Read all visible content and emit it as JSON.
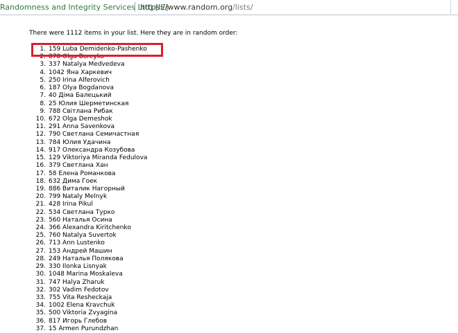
{
  "address_bar": {
    "identity": "Randomness and Integrity Services Ltd) [IE]",
    "url_host": "https://www.random.org",
    "url_path": "/lists/"
  },
  "page": {
    "intro": "There were 1112 items in your list. Here they are in random order:",
    "items": [
      {
        "n": "1.",
        "text": "159 Luba Demidenko-Pashenko"
      },
      {
        "n": "2.",
        "text": "878 Olga Boreyko"
      },
      {
        "n": "3.",
        "text": "337 Natalya Medvedeva"
      },
      {
        "n": "4.",
        "text": "1042 Яна Харкевич"
      },
      {
        "n": "5.",
        "text": "250 Irina Alferovich"
      },
      {
        "n": "6.",
        "text": "187 Olya Bogdanova"
      },
      {
        "n": "7.",
        "text": "40 Діма Балецький"
      },
      {
        "n": "8.",
        "text": "25 Юлия Шерметинская"
      },
      {
        "n": "9.",
        "text": "788 Світлана Рибак"
      },
      {
        "n": "10.",
        "text": "672 Olga Demeshok"
      },
      {
        "n": "11.",
        "text": "291 Anna Savenkova"
      },
      {
        "n": "12.",
        "text": "790 Светлана Семичастная"
      },
      {
        "n": "13.",
        "text": "784 Юлия Удачина"
      },
      {
        "n": "14.",
        "text": "917 Олександра Козубова"
      },
      {
        "n": "15.",
        "text": "129 Viktoriya Miranda Fedulova"
      },
      {
        "n": "16.",
        "text": "379 Светлана Хан"
      },
      {
        "n": "17.",
        "text": "58 Елена Романкова"
      },
      {
        "n": "18.",
        "text": "632 Дима Гоек"
      },
      {
        "n": "19.",
        "text": "886 Виталик Нагорный"
      },
      {
        "n": "20.",
        "text": "799 Nataly Melnyk"
      },
      {
        "n": "21.",
        "text": "428 Irina Pikul"
      },
      {
        "n": "22.",
        "text": "534 Светлана Турко"
      },
      {
        "n": "23.",
        "text": "560 Наталья Осина"
      },
      {
        "n": "24.",
        "text": "366 Alexandra Kiritchenko"
      },
      {
        "n": "25.",
        "text": "760 Natalya Suvertok"
      },
      {
        "n": "26.",
        "text": "713 Ann Lustenko"
      },
      {
        "n": "27.",
        "text": "153 Андрей Машин"
      },
      {
        "n": "28.",
        "text": "249 Наталья Полякова"
      },
      {
        "n": "29.",
        "text": "330 Ilonka Lisnyak"
      },
      {
        "n": "30.",
        "text": "1048 Marina Moskaleva"
      },
      {
        "n": "31.",
        "text": "747 Halya Zharuk"
      },
      {
        "n": "32.",
        "text": "302 Vadim Fedotov"
      },
      {
        "n": "33.",
        "text": "755 Vita Resheckaja"
      },
      {
        "n": "34.",
        "text": "1002 Elena Kravchuk"
      },
      {
        "n": "35.",
        "text": "500 Viktoria Zvyagina"
      },
      {
        "n": "36.",
        "text": "817 Игорь Глебов"
      },
      {
        "n": "37.",
        "text": "15 Armen Purundzhan"
      }
    ]
  },
  "colors": {
    "highlight_border": "#d8202c",
    "identity_text": "#2b7a3a"
  }
}
